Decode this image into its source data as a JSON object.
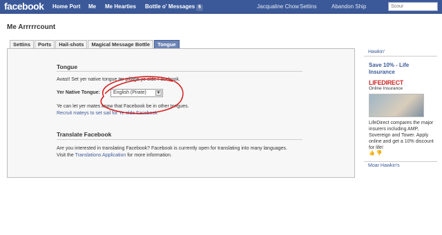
{
  "topbar": {
    "logo": "facebook",
    "nav": [
      "Home Port",
      "Me",
      "Me Hearties",
      "Bottle o' Messages"
    ],
    "messages_count": "6",
    "user_name": "Jacqualine Chow",
    "settings": "Settins",
    "logout": "Abandon Ship",
    "search_placeholder": "Scour"
  },
  "page_title": "Me Arrrrrcount",
  "tabs": [
    "Settins",
    "Ports",
    "Hail-shots",
    "Magical Message Bottle",
    "Tongue"
  ],
  "active_tab": "Tongue",
  "tongue": {
    "title": "Tongue",
    "intro": "Avast! Set yer native tongue ter pillage ye olde Facebook.",
    "field_label": "Yer Native Tongue:",
    "selected": "English (Pirate)",
    "note": "Ye can let yer mates know that Facebook be in other tongues.",
    "recruit_link": "Recruit mateys to set sail for Ye olde Facebook"
  },
  "translate": {
    "title": "Translate Facebook",
    "line1": "Are you interested in translating Facebook? Facebook is currently open for translating into many languages.",
    "line2_prefix": "Visit the ",
    "line2_link": "Translations Application",
    "line2_suffix": " for more information."
  },
  "sidebar": {
    "header": "Hawkin'",
    "ad_title": "Save 10% - Life Insurance",
    "ad_brand": "LIFEDIRECT",
    "ad_brand_sub": "Online Insurance",
    "ad_text": "LifeDirect compares the major insurers including AMP, Sovereign and Tower. Apply online and get a 10% discount for life!",
    "footer": "Moar Hawkin's"
  },
  "colors": {
    "brand_blue": "#3b5998",
    "annotation_red": "#d42020"
  }
}
